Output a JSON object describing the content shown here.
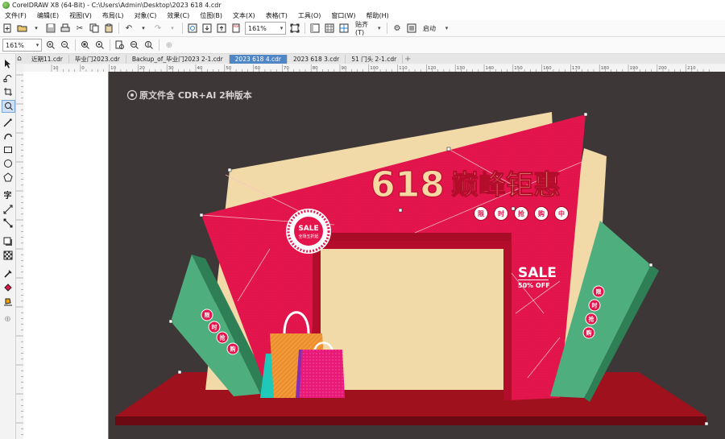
{
  "window": {
    "title": "CorelDRAW X8 (64-Bit) - C:\\Users\\Admin\\Desktop\\2023 618 4.cdr"
  },
  "menu": [
    "文件(F)",
    "编辑(E)",
    "视图(V)",
    "布局(L)",
    "对象(C)",
    "效果(C)",
    "位图(B)",
    "文本(X)",
    "表格(T)",
    "工具(O)",
    "窗口(W)",
    "帮助(H)"
  ],
  "toolbar": {
    "zoom_value": "161%",
    "snap_label": "贴齐(T)",
    "launch_label": "启动"
  },
  "property_bar": {
    "zoom_value": "161%"
  },
  "tabs": [
    {
      "label": "近期11.cdr",
      "active": false
    },
    {
      "label": "毕业门2023.cdr",
      "active": false
    },
    {
      "label": "Backup_of_毕业门2023 2-1.cdr",
      "active": false
    },
    {
      "label": "2023 618 4.cdr",
      "active": true
    },
    {
      "label": "2023 618 3.cdr",
      "active": false
    },
    {
      "label": "51 门头 2-1.cdr",
      "active": false
    }
  ],
  "ruler": {
    "ticks": [
      "10",
      "0",
      "10",
      "20",
      "30",
      "40",
      "50",
      "60",
      "70",
      "80",
      "90",
      "100",
      "110",
      "120",
      "130",
      "140",
      "150",
      "160",
      "170",
      "180",
      "190",
      "200",
      "210"
    ]
  },
  "artwork": {
    "note": "原文件含 CDR+AI 2种版本",
    "headline_number": "618",
    "headline_text": "巅峰钜惠",
    "sub_chars": [
      "限",
      "时",
      "抢",
      "购",
      "中"
    ],
    "badge_top": "SALE",
    "badge_bottom": "全场五折起",
    "sale_text": "SALE",
    "sale_sub": "50% OFF",
    "left_panel_chars": [
      "限",
      "时",
      "抢",
      "购"
    ],
    "right_panel_chars": [
      "限",
      "时",
      "抢",
      "购"
    ]
  },
  "colors": {
    "canvas_bg": "#3e3737",
    "arch_red": "#e3154c",
    "panel_green": "#4eae7e",
    "panel_cream": "#f1d9a8",
    "floor_red": "#a0111e",
    "headline_cream": "#f6d8a2",
    "active_tab": "#4f86c6"
  }
}
